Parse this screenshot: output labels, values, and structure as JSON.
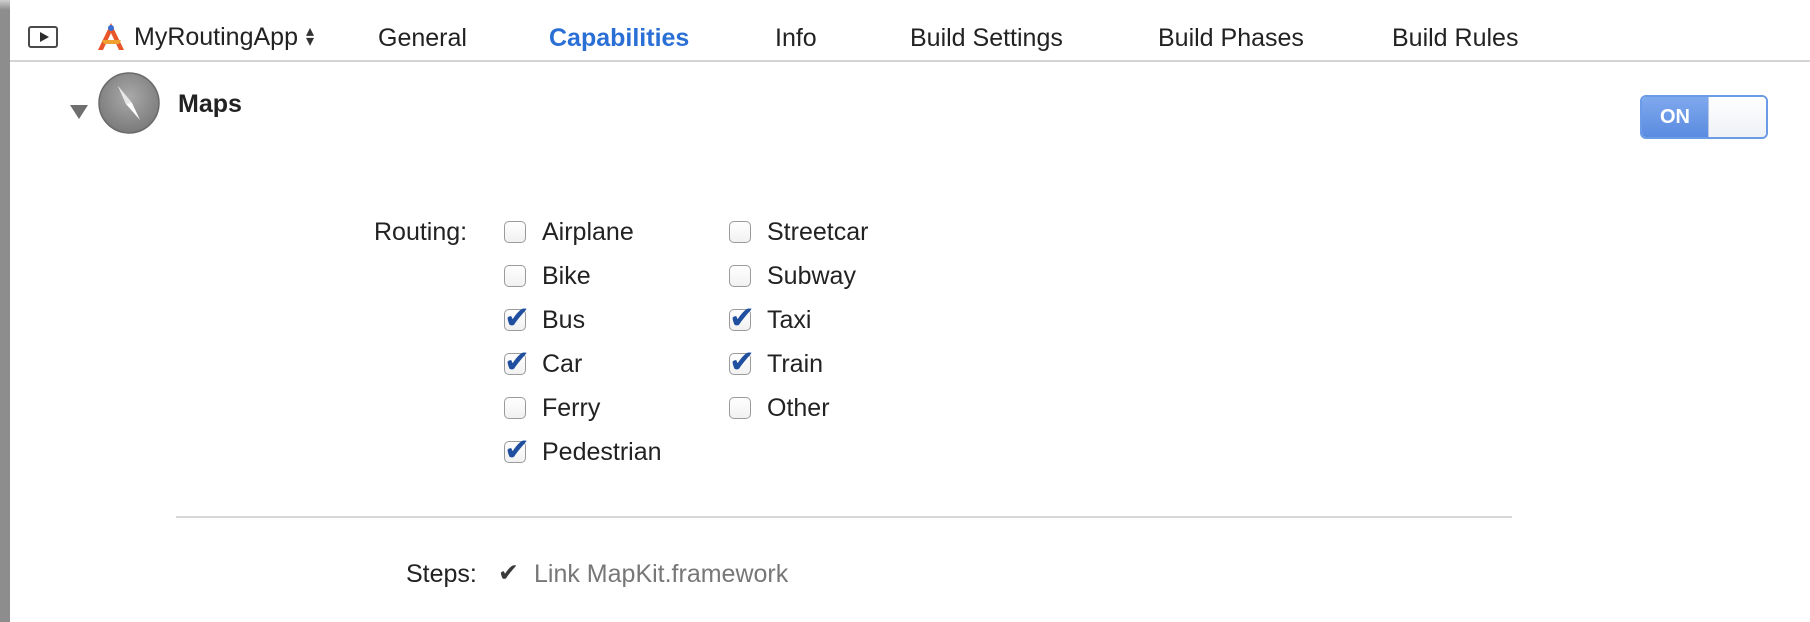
{
  "target": {
    "name": "MyRoutingApp"
  },
  "tabs": [
    {
      "label": "General"
    },
    {
      "label": "Capabilities",
      "active": true
    },
    {
      "label": "Info"
    },
    {
      "label": "Build Settings"
    },
    {
      "label": "Build Phases"
    },
    {
      "label": "Build Rules"
    }
  ],
  "capability": {
    "title": "Maps",
    "switch_label": "ON",
    "switch_on": true,
    "routing_label": "Routing:",
    "options_col1": [
      {
        "label": "Airplane",
        "checked": false
      },
      {
        "label": "Bike",
        "checked": false
      },
      {
        "label": "Bus",
        "checked": true
      },
      {
        "label": "Car",
        "checked": true
      },
      {
        "label": "Ferry",
        "checked": false
      },
      {
        "label": "Pedestrian",
        "checked": true
      }
    ],
    "options_col2": [
      {
        "label": "Streetcar",
        "checked": false
      },
      {
        "label": "Subway",
        "checked": false
      },
      {
        "label": "Taxi",
        "checked": true
      },
      {
        "label": "Train",
        "checked": true
      },
      {
        "label": "Other",
        "checked": false
      }
    ],
    "steps_label": "Steps:",
    "steps_text": "Link MapKit.framework"
  },
  "colors": {
    "accent": "#2a6fd6",
    "switch_on": "#5b8be0",
    "check": "#1f4f9e"
  }
}
